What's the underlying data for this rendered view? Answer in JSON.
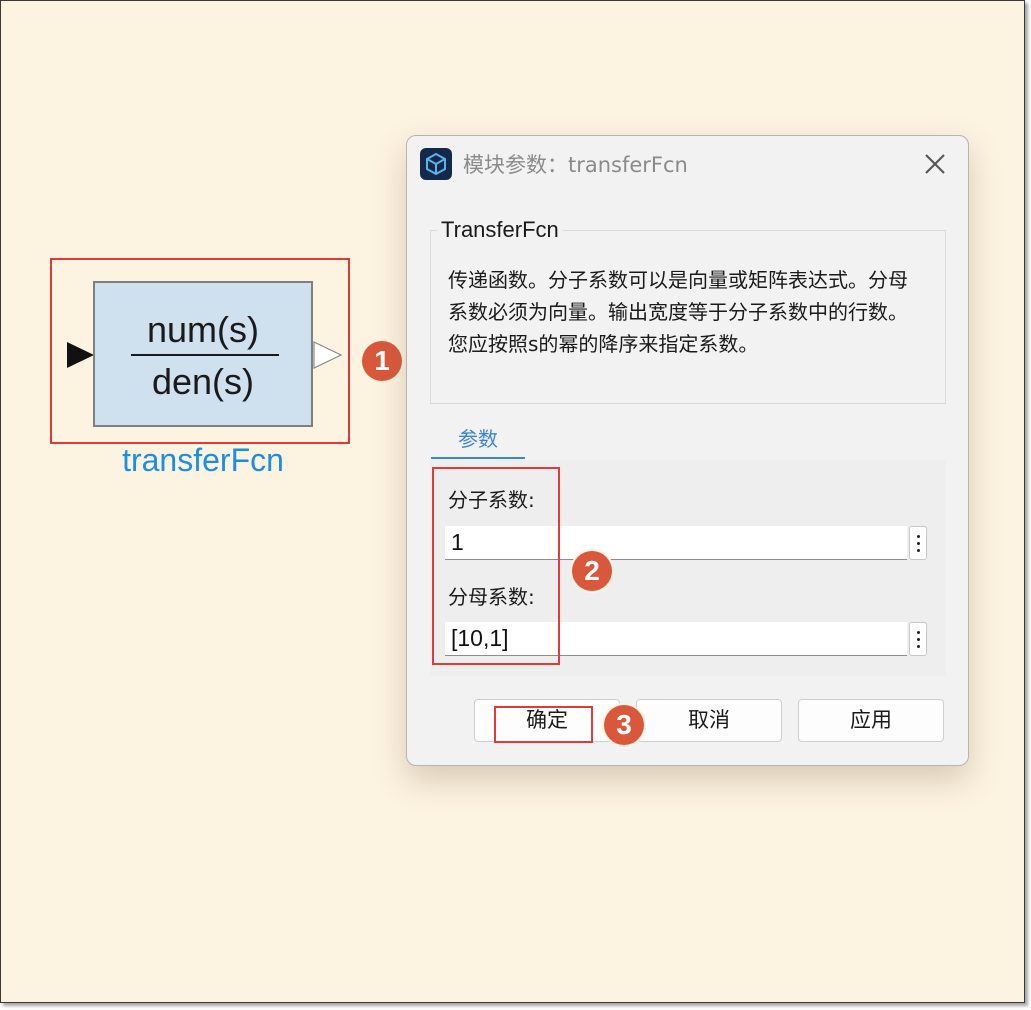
{
  "block": {
    "numerator": "num(s)",
    "denominator": "den(s)",
    "name": "transferFcn"
  },
  "callouts": [
    "1",
    "2",
    "3"
  ],
  "dialog": {
    "title": "模块参数：transferFcn",
    "section_title": "TransferFcn",
    "description": "传递函数。分子系数可以是向量或矩阵表达式。分母系数必须为向量。输出宽度等于分子系数中的行数。您应按照s的幂的降序来指定系数。",
    "tab": "参数",
    "numerator_label": "分子系数:",
    "numerator_value": "1",
    "denominator_label": "分母系数:",
    "denominator_value": "[10,1]",
    "buttons": {
      "ok": "确定",
      "cancel": "取消",
      "apply": "应用"
    }
  },
  "colors": {
    "canvas": "#fdf3e1",
    "block_fill": "#cfe0ef",
    "block_name": "#1c8ee6",
    "annotation_frame": "#e23a3a",
    "callout_badge": "#d9583b",
    "tab_accent": "#3a86d6"
  },
  "icons": [
    "app-cube-icon",
    "close-icon",
    "more-options-icon",
    "input-port-arrow-icon",
    "output-port-arrow-icon"
  ]
}
